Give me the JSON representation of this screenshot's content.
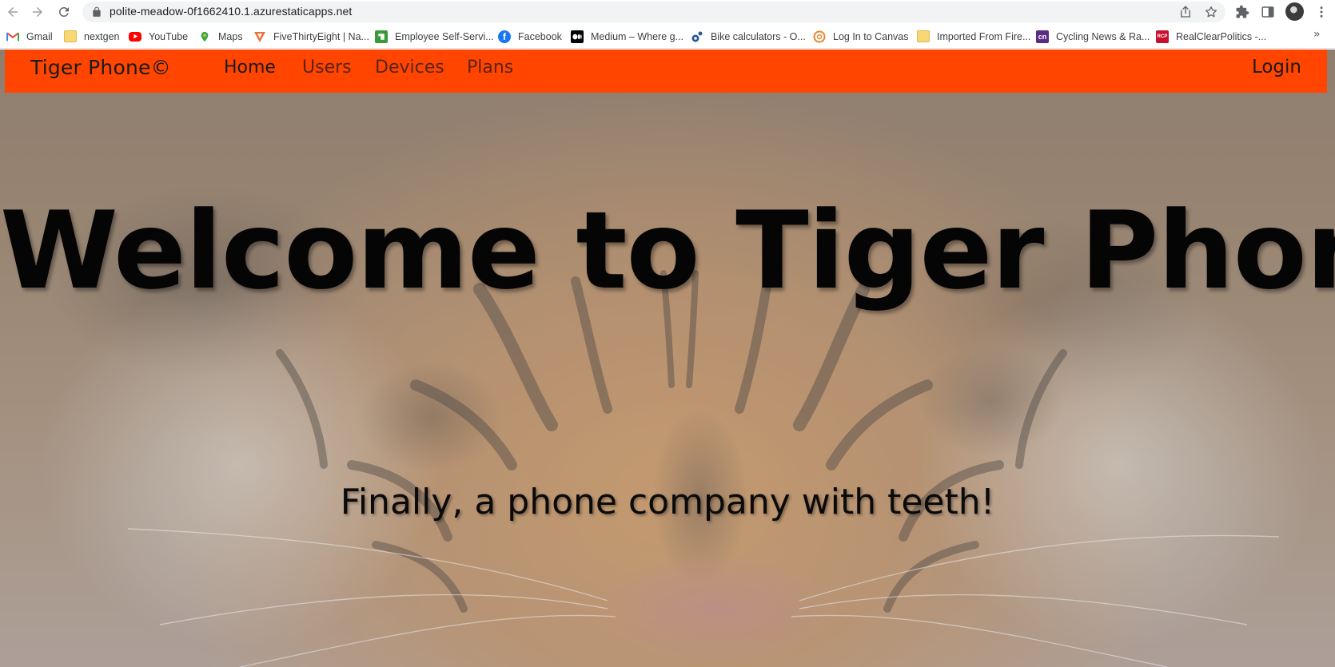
{
  "browser": {
    "url": "polite-meadow-0f1662410.1.azurestaticapps.net",
    "bookmarks": [
      {
        "label": "Gmail",
        "icon": "gmail-icon",
        "color": "#ea4335"
      },
      {
        "label": "nextgen",
        "icon": "folder-icon",
        "color": "#f8d775"
      },
      {
        "label": "YouTube",
        "icon": "youtube-icon",
        "color": "#ff0000"
      },
      {
        "label": "Maps",
        "icon": "maps-icon",
        "color": "#34a853"
      },
      {
        "label": "FiveThirtyEight | Na...",
        "icon": "fivethirtyeight-icon",
        "color": "#ed713a"
      },
      {
        "label": "Employee Self-Servi...",
        "icon": "employee-portal-icon",
        "color": "#3a9a3a"
      },
      {
        "label": "Facebook",
        "icon": "facebook-icon",
        "color": "#1877f2"
      },
      {
        "label": "Medium – Where g...",
        "icon": "medium-icon",
        "color": "#000000"
      },
      {
        "label": "Bike calculators - O...",
        "icon": "bike-calculator-icon",
        "color": "#2b5797"
      },
      {
        "label": "Log In to Canvas",
        "icon": "canvas-icon",
        "color": "#e5862a"
      },
      {
        "label": "Imported From Fire...",
        "icon": "folder-icon",
        "color": "#f8d775"
      },
      {
        "label": "Cycling News & Ra...",
        "icon": "cyclingnews-icon",
        "color": "#5b2c83"
      },
      {
        "label": "RealClearPolitics -...",
        "icon": "realclearpolitics-icon",
        "color": "#c8102e"
      }
    ],
    "bookmark_glyphs": {
      "cyclingnews": "cn",
      "realclearpolitics": "RCP"
    },
    "overflow": "»"
  },
  "site": {
    "brand": "Tiger Phone©",
    "nav": [
      {
        "label": "Home",
        "active": true
      },
      {
        "label": "Users",
        "active": false
      },
      {
        "label": "Devices",
        "active": false
      },
      {
        "label": "Plans",
        "active": false
      }
    ],
    "login_label": "Login",
    "headline": "Welcome to Tiger Phone",
    "tagline": "Finally, a phone company with teeth!",
    "accent_color": "#ff4500"
  }
}
